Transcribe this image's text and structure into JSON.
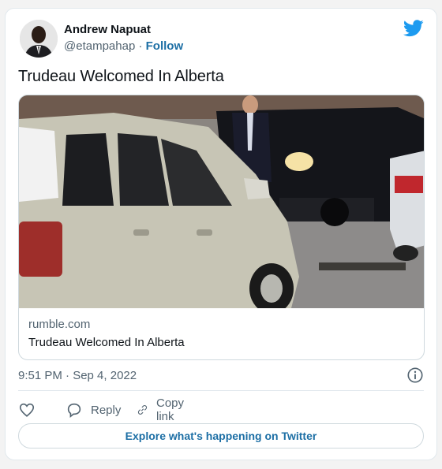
{
  "author": {
    "name": "Andrew Napuat",
    "handle": "@etampahap",
    "separator": "·",
    "follow_label": "Follow"
  },
  "tweet": {
    "text": "Trudeau Welcomed In Alberta",
    "timestamp": "9:51 PM · Sep 4, 2022"
  },
  "link_card": {
    "domain": "rumble.com",
    "title": "Trudeau Welcomed In Alberta"
  },
  "actions": {
    "like_icon": "heart-icon",
    "reply_label": "Reply",
    "copy_link_label": "Copy link"
  },
  "explore": {
    "label": "Explore what's happening on Twitter"
  },
  "colors": {
    "twitter_blue": "#1d9bf0",
    "link_blue": "#1d6fa5",
    "secondary_text": "#536471",
    "border": "#cfd9de"
  }
}
